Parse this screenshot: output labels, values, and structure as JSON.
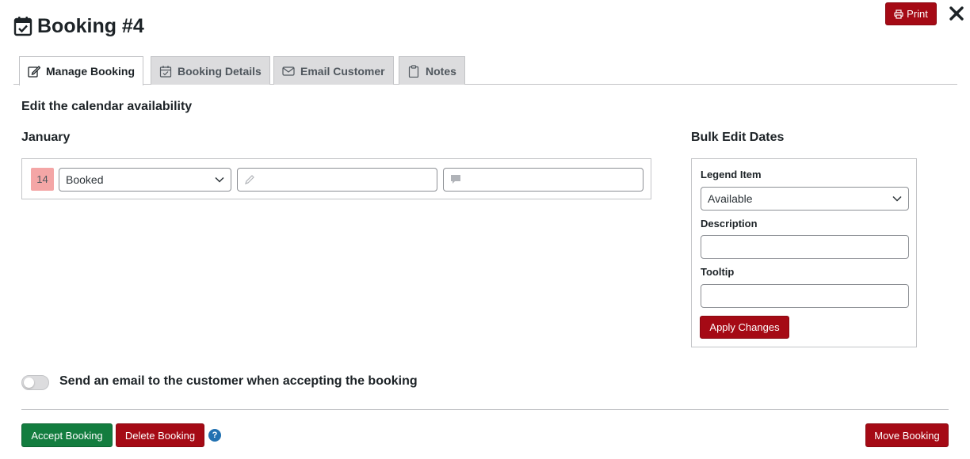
{
  "header": {
    "title": "Booking #4",
    "title_icon": "calendar-check-icon",
    "print_label": "Print",
    "print_icon": "printer-icon",
    "close_icon": "close-icon"
  },
  "tabs": [
    {
      "label": "Manage Booking",
      "icon": "edit-icon",
      "active": true
    },
    {
      "label": "Booking Details",
      "icon": "calendar-icon",
      "active": false
    },
    {
      "label": "Email Customer",
      "icon": "envelope-icon",
      "active": false
    },
    {
      "label": "Notes",
      "icon": "clipboard-icon",
      "active": false
    }
  ],
  "main": {
    "section_title": "Edit the calendar availability",
    "month": "January",
    "dates": [
      {
        "day": "14",
        "status": "Booked",
        "description": "",
        "tooltip": ""
      }
    ]
  },
  "bulk": {
    "title": "Bulk Edit Dates",
    "legend_label": "Legend Item",
    "legend_value": "Available",
    "description_label": "Description",
    "description_value": "",
    "tooltip_label": "Tooltip",
    "tooltip_value": "",
    "apply_label": "Apply Changes"
  },
  "email_toggle": {
    "label": "Send an email to the customer when accepting the booking",
    "on": false
  },
  "footer": {
    "accept_label": "Accept Booking",
    "delete_label": "Delete Booking",
    "help_text": "?",
    "move_label": "Move Booking"
  },
  "colors": {
    "accent_red": "#a50a15",
    "accept_green": "#137d3f",
    "booked_badge": "#f4a6a6",
    "help_blue": "#2271b1"
  }
}
